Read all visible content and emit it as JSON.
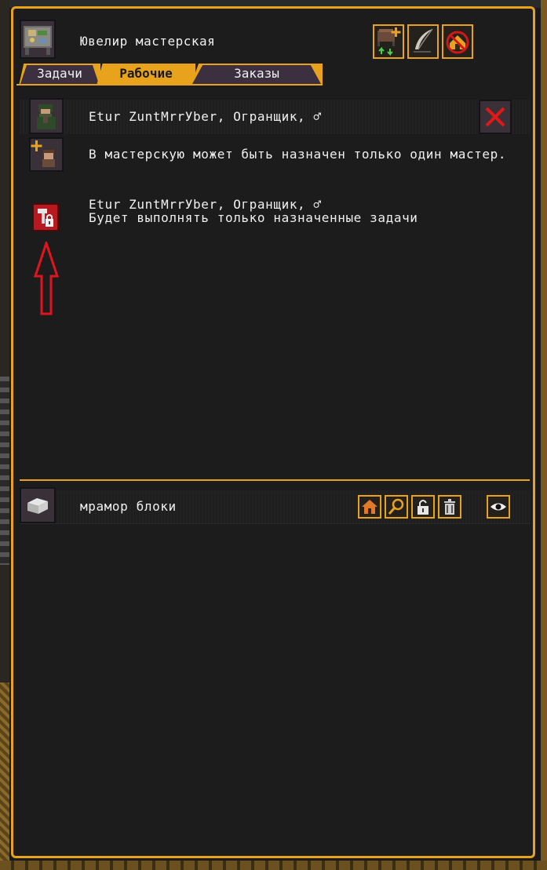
{
  "workshop": {
    "title": "Ювелир мастерская"
  },
  "toolbar": {
    "icons": [
      "add-worker-icon",
      "quill-icon",
      "no-house-icon"
    ]
  },
  "tabs": [
    {
      "label": "Задачи",
      "active": false
    },
    {
      "label": "Рабочие",
      "active": true
    },
    {
      "label": "Заказы",
      "active": false
    }
  ],
  "workers": {
    "assigned_name": "Etur ZuntMrrУber, Огранщик, ♂",
    "info_message": "В мастерскую может быть назначен только один мастер.",
    "restricted_name": "Etur ZuntMrrУber, Огранщик, ♂",
    "restricted_note": "Будет выполнять только назначенные задачи"
  },
  "material": {
    "label": "мрамор блоки",
    "action_icons": [
      "house-icon",
      "magnifier-icon",
      "unlock-icon",
      "trash-icon",
      "eye-icon"
    ]
  },
  "colors": {
    "accent": "#e8a21c",
    "panel_bg": "#1c1c1c",
    "annotation_red": "#e0141e"
  }
}
